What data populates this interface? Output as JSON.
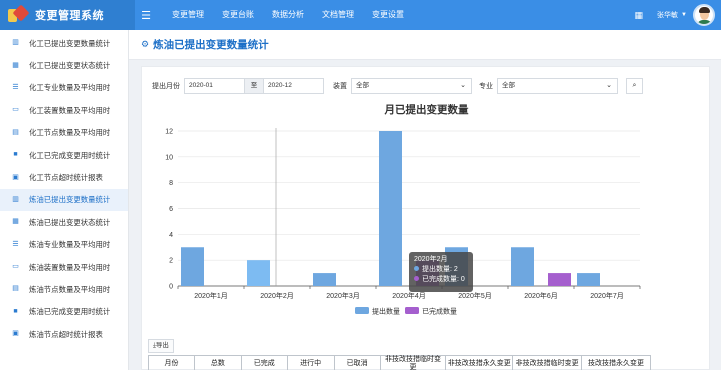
{
  "app": {
    "title": "变更管理系统"
  },
  "nav": {
    "items": [
      "变更管理",
      "变更台账",
      "数据分析",
      "文档管理",
      "变更设置"
    ]
  },
  "user": {
    "name": "张华敏"
  },
  "sidebar": {
    "items": [
      {
        "label": "化工已提出变更数量统计",
        "icon": "columns-icon"
      },
      {
        "label": "化工已提出变更状态统计",
        "icon": "grid-icon"
      },
      {
        "label": "化工专业数量及平均用时",
        "icon": "list-icon"
      },
      {
        "label": "化工装置数量及平均用时",
        "icon": "card-icon"
      },
      {
        "label": "化工节点数量及平均用时",
        "icon": "calendar-icon"
      },
      {
        "label": "化工已完成变更用时统计",
        "icon": "briefcase-icon"
      },
      {
        "label": "化工节点超时统计报表",
        "icon": "report-icon"
      },
      {
        "label": "炼油已提出变更数量统计",
        "icon": "columns-icon"
      },
      {
        "label": "炼油已提出变更状态统计",
        "icon": "grid-icon"
      },
      {
        "label": "炼油专业数量及平均用时",
        "icon": "list-icon"
      },
      {
        "label": "炼油装置数量及平均用时",
        "icon": "card-icon"
      },
      {
        "label": "炼油节点数量及平均用时",
        "icon": "calendar-icon"
      },
      {
        "label": "炼油已完成变更用时统计",
        "icon": "briefcase-icon"
      },
      {
        "label": "炼油节点超时统计报表",
        "icon": "report-icon"
      }
    ],
    "active_index": 7
  },
  "page": {
    "title": "炼油已提出变更数量统计"
  },
  "filters": {
    "month_label": "提出月份",
    "start_month": "2020-01",
    "to_label": "至",
    "end_month": "2020-12",
    "unit_label": "装置",
    "unit_value": "全部",
    "major_label": "专业",
    "major_value": "全部"
  },
  "chart_data": {
    "type": "bar",
    "title": "月已提出变更数量",
    "categories": [
      "2020年1月",
      "2020年2月",
      "2020年3月",
      "2020年4月",
      "2020年5月",
      "2020年6月",
      "2020年7月"
    ],
    "series": [
      {
        "name": "提出数量",
        "values": [
          3,
          2,
          1,
          12,
          3,
          3,
          1
        ],
        "color": "#6ea7e0"
      },
      {
        "name": "已完成数量",
        "values": [
          0,
          0,
          0,
          2,
          0,
          1,
          0
        ],
        "color": "#a55fce"
      }
    ],
    "ylim": [
      0,
      12
    ],
    "yticks": [
      0,
      2,
      4,
      6,
      8,
      10,
      12
    ],
    "highlight_category_index": 1,
    "highlight_series_color": "#7dbbf2",
    "grid": "horizontal",
    "legend_position": "bottom"
  },
  "tooltip": {
    "title": "2020年2月",
    "rows": [
      {
        "label": "提出数量: 2",
        "color": "#6ea7e0"
      },
      {
        "label": "已完成数量: 0",
        "color": "#a55fce"
      }
    ]
  },
  "export": {
    "label": "导出"
  },
  "table": {
    "columns": [
      "月份",
      "总数",
      "已完成",
      "进行中",
      "已取消",
      "非技改技措临时变更",
      "非技改技措永久变更",
      "非技改技措临时变更",
      "技改技措永久变更"
    ]
  },
  "colors": {
    "brand": "#3a8ee6",
    "accent": "#1c6fc7"
  }
}
